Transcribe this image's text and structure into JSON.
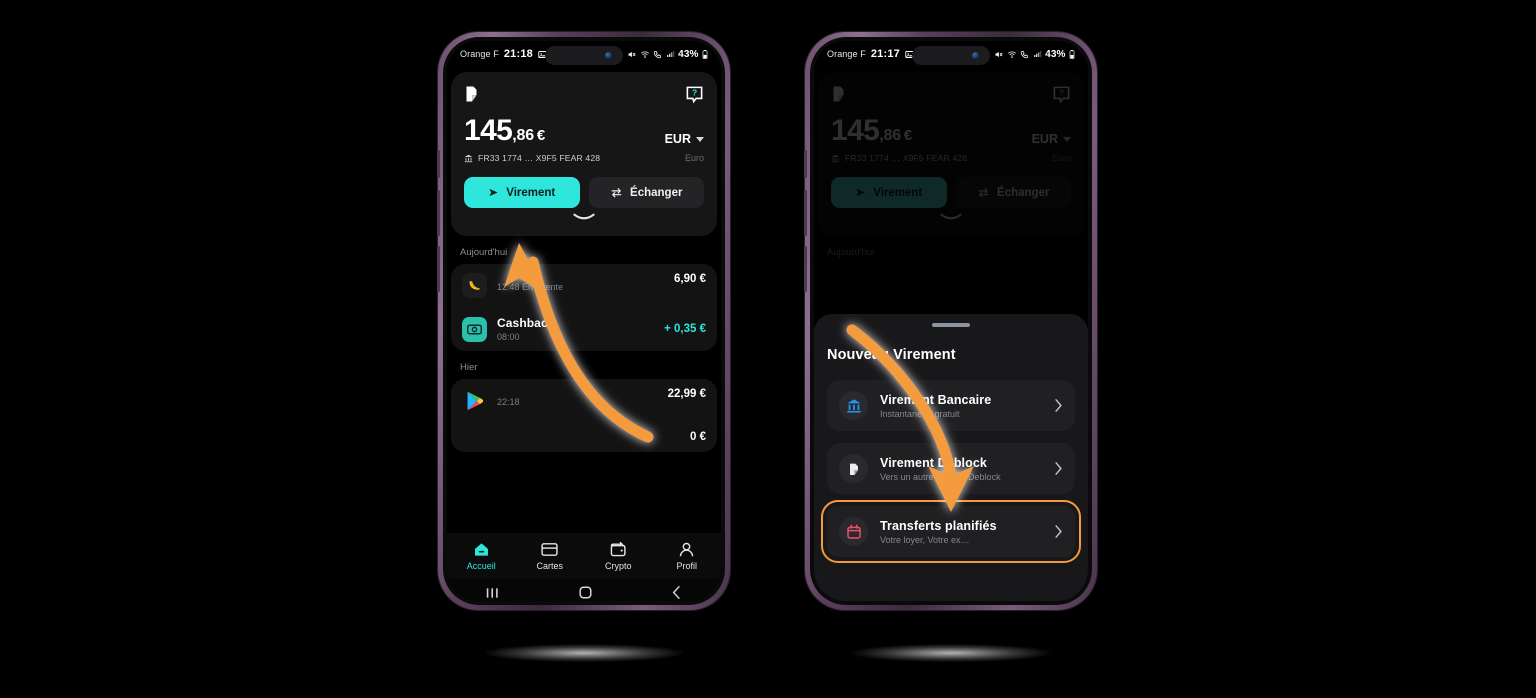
{
  "phone1": {
    "statusbar": {
      "carrier": "Orange F",
      "time": "21:18",
      "battery": "43%"
    },
    "card": {
      "logo_icon": "deblock-logo-icon",
      "help_icon": "help-chat-icon",
      "balance_int": "145",
      "balance_dec": ",86",
      "balance_currency_symbol": "€",
      "currency_code": "EUR",
      "currency_name": "Euro",
      "iban": "FR33 1774 … X9F5 FEAR 428",
      "primary_button": "Virement",
      "secondary_button": "Échanger"
    },
    "sections": [
      {
        "header": "Aujourd'hui",
        "rows": [
          {
            "icon": "banana-icon",
            "name": "",
            "time": "12:48 En attente",
            "amount": "6,90 €",
            "positive": false
          },
          {
            "icon": "cashback-icon",
            "name": "Cashback",
            "time": "08:00",
            "amount": "+ 0,35 €",
            "positive": true
          }
        ]
      },
      {
        "header": "Hier",
        "rows": [
          {
            "icon": "google-play-icon",
            "name": "",
            "time": "22:18",
            "amount": "22,99 €",
            "positive": false
          },
          {
            "icon": "",
            "name": "",
            "time": "",
            "amount": "0 €",
            "positive": false
          }
        ]
      }
    ],
    "tabs": [
      {
        "label": "Accueil",
        "icon": "home-icon",
        "active": true
      },
      {
        "label": "Cartes",
        "icon": "card-icon",
        "active": false
      },
      {
        "label": "Crypto",
        "icon": "wallet-icon",
        "active": false
      },
      {
        "label": "Profil",
        "icon": "person-icon",
        "active": false
      }
    ]
  },
  "phone2": {
    "statusbar": {
      "carrier": "Orange F",
      "time": "21:17",
      "battery": "43%"
    },
    "card": {
      "balance_int": "145",
      "balance_dec": ",86",
      "balance_currency_symbol": "€",
      "currency_code": "EUR",
      "currency_name": "Euro",
      "iban": "FR33 1774 … X9F5 FEAR 428",
      "primary_button": "Virement",
      "secondary_button": "Échanger"
    },
    "section_header": "Aujourd'hui",
    "sheet": {
      "title": "Nouveau Virement",
      "options": [
        {
          "icon": "bank-icon",
          "title": "Virement Bancaire",
          "subtitle": "Instantané et gratuit",
          "highlighted": false
        },
        {
          "icon": "deblock-icon",
          "title": "Virement Deblock",
          "subtitle": "Vers un autre compte Deblock",
          "highlighted": false
        },
        {
          "icon": "calendar-icon",
          "title": "Transferts planifiés",
          "subtitle": "Votre loyer, Votre ex…",
          "highlighted": true
        }
      ]
    }
  },
  "annotations": {
    "arrow_color": "#f39b3c",
    "glow_color": "#ffffff",
    "highlight_color": "#f39b3c"
  },
  "theme": {
    "accent": "#2ee6db",
    "background": "#000000",
    "card": "#161617",
    "frame": "#7a5b7c"
  }
}
